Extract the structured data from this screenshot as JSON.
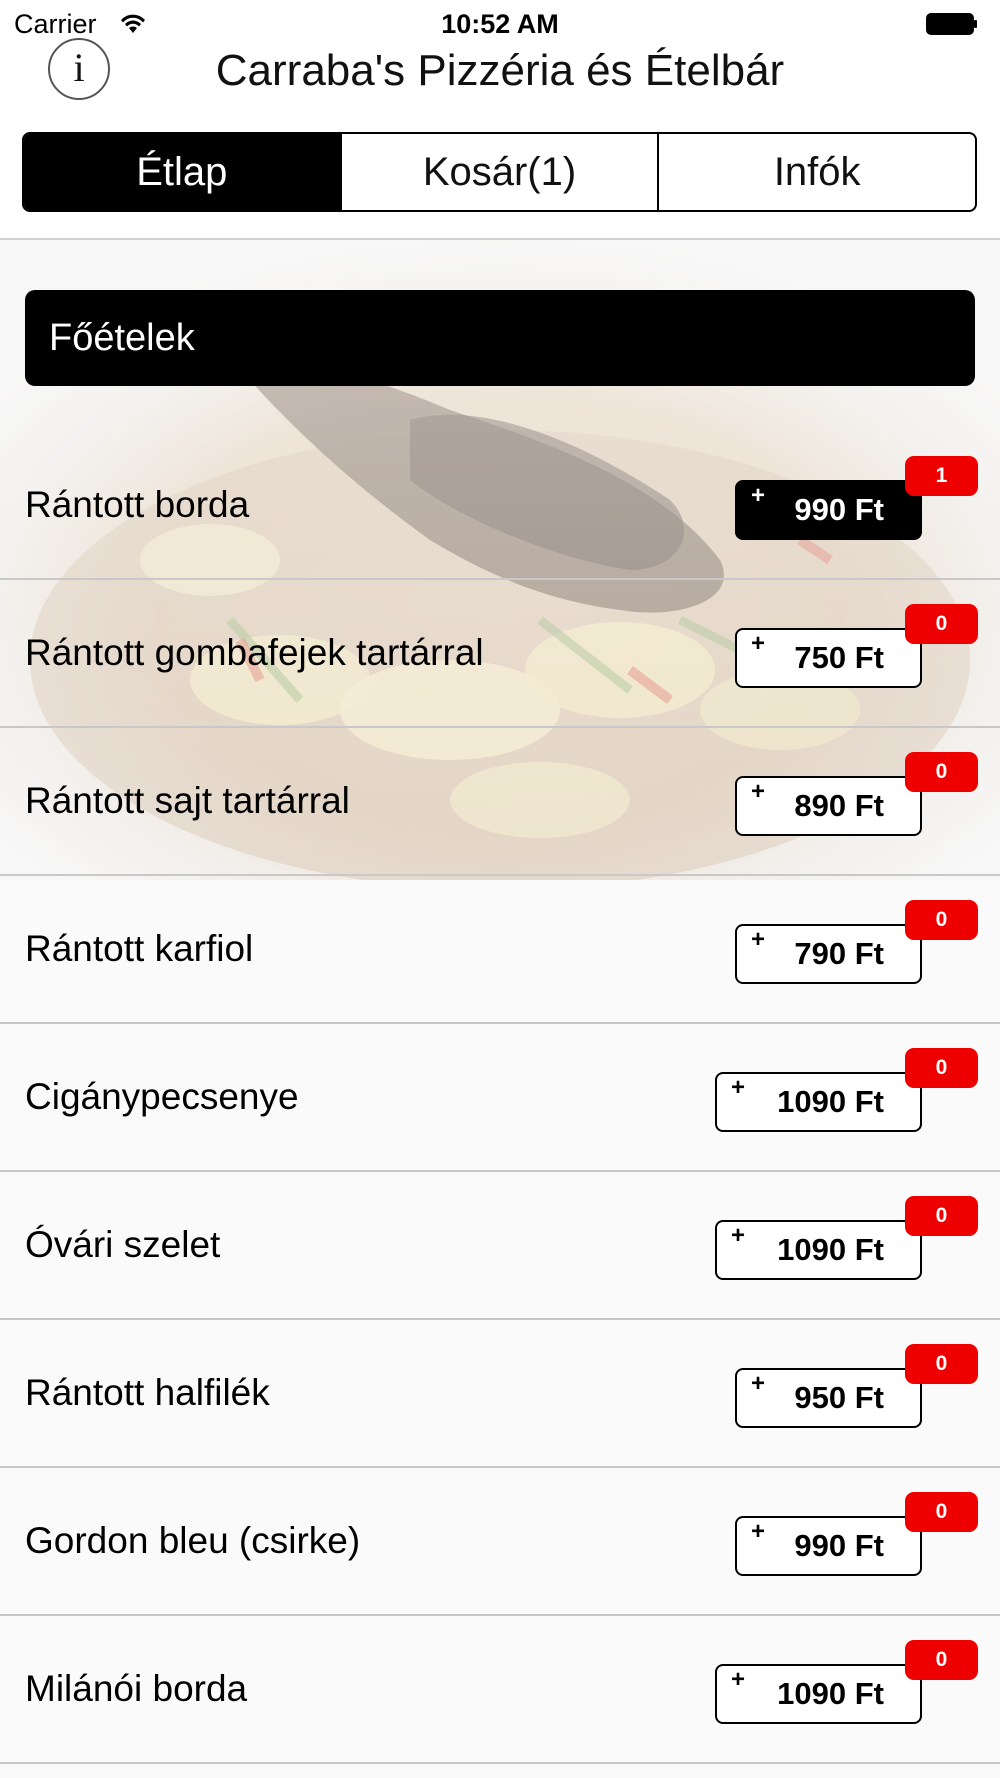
{
  "status_bar": {
    "carrier": "Carrier",
    "time": "10:52 AM",
    "wifi_icon": "wifi-icon",
    "battery_icon": "battery-icon"
  },
  "header": {
    "info_icon_glyph": "i",
    "title": "Carraba's Pizzéria és Ételbár"
  },
  "tabs": [
    {
      "label": "Étlap",
      "active": true
    },
    {
      "label": "Kosár(1)",
      "active": false
    },
    {
      "label": "Infók",
      "active": false
    }
  ],
  "section": {
    "title": "Főételek"
  },
  "menu": {
    "plus_symbol": "+",
    "items": [
      {
        "name": "Rántott borda",
        "price": "990 Ft",
        "count": "1",
        "selected": true
      },
      {
        "name": "Rántott gombafejek tartárral",
        "price": "750 Ft",
        "count": "0",
        "selected": false
      },
      {
        "name": "Rántott sajt tartárral",
        "price": "890 Ft",
        "count": "0",
        "selected": false
      },
      {
        "name": "Rántott karfiol",
        "price": "790 Ft",
        "count": "0",
        "selected": false
      },
      {
        "name": "Cigánypecsenye",
        "price": "1090 Ft",
        "count": "0",
        "selected": false
      },
      {
        "name": "Óvári szelet",
        "price": "1090 Ft",
        "count": "0",
        "selected": false
      },
      {
        "name": "Rántott halfilék",
        "price": "950 Ft",
        "count": "0",
        "selected": false
      },
      {
        "name": "Gordon bleu (csirke)",
        "price": "990 Ft",
        "count": "0",
        "selected": false
      },
      {
        "name": "Milánói borda",
        "price": "1090 Ft",
        "count": "0",
        "selected": false
      }
    ]
  },
  "colors": {
    "accent": "#000000",
    "badge": "#ee0000",
    "separator": "#c8c8c8"
  }
}
